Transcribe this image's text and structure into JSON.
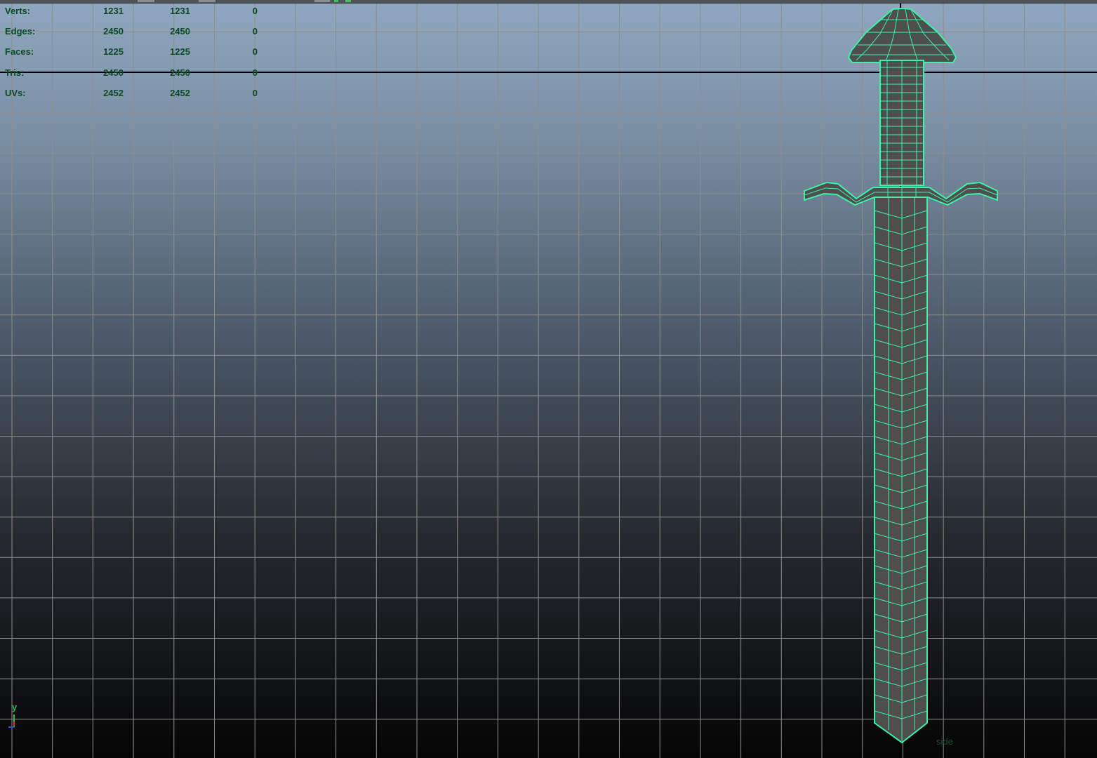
{
  "hud": {
    "rows": [
      {
        "label": "Verts:",
        "v1": "1231",
        "v2": "1231",
        "v3": "0"
      },
      {
        "label": "Edges:",
        "v1": "2450",
        "v2": "2450",
        "v3": "0"
      },
      {
        "label": "Faces:",
        "v1": "1225",
        "v2": "1225",
        "v3": "0"
      },
      {
        "label": "Tris:",
        "v1": "2450",
        "v2": "2450",
        "v3": "0"
      },
      {
        "label": "UVs:",
        "v1": "2452",
        "v2": "2452",
        "v3": "0"
      }
    ]
  },
  "axis": {
    "y_label": "y"
  },
  "viewport": {
    "camera_label": "side"
  },
  "colors": {
    "wire": "#3ff0a8",
    "mesh_fill": "#4e4e4e",
    "grid": "#8e8e8e",
    "grid_axis": "#000000",
    "bg_top": "#8fa7bf",
    "bg_bottom": "#050505",
    "hud_text": "#0d4a27"
  }
}
